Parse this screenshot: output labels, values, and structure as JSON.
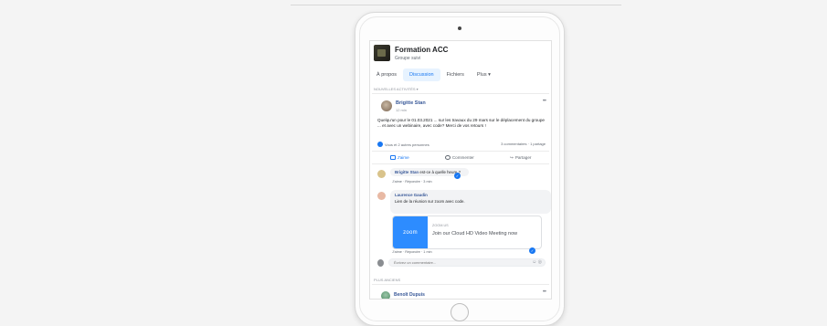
{
  "group": {
    "name": "Formation ACC",
    "subtitle": "Groupe suivi"
  },
  "tabs": [
    {
      "label": "À propos"
    },
    {
      "label": "Discussion"
    },
    {
      "label": "Fichiers"
    },
    {
      "label": "Plus ▾"
    }
  ],
  "sort_label": "NOUVELLES ACTIVITÉS ▾",
  "post": {
    "author": "Brigitte Stan",
    "time": "12 min",
    "text": "Quelqu'un pour le 01.03.2021 ... sur les travaux du 29 mars sur le déplacement du groupe ... et avec un webinaire, avec code? Merci de vos retours !",
    "reactions": "Vous et 2 autres personnes",
    "counts": "3 commentaires · 1 partage",
    "actions": [
      "J'aime",
      "Commenter",
      "Partager"
    ]
  },
  "comments": [
    {
      "name": "Brigitte Stan",
      "text": "est-ce à quelle heure ?",
      "meta": "J'aime · Répondre · 3 min"
    },
    {
      "name": "Laurence Gaudin",
      "text": "Lien de la réunion sur zoom avec code.",
      "meta": "J'aime · Répondre · 1 min"
    }
  ],
  "link_preview": {
    "thumb": "zoom",
    "domain": "ZOOM.US",
    "title": "Join our Cloud HD Video Meeting now"
  },
  "comment_input": {
    "placeholder": "Écrivez un commentaire..."
  },
  "section_label": "PLUS ANCIENS",
  "next_post": {
    "author": "Benoît Dupuis"
  },
  "colors": {
    "facebook_blue": "#1877f2",
    "link_blue": "#385898",
    "zoom_blue": "#2d8cff"
  }
}
